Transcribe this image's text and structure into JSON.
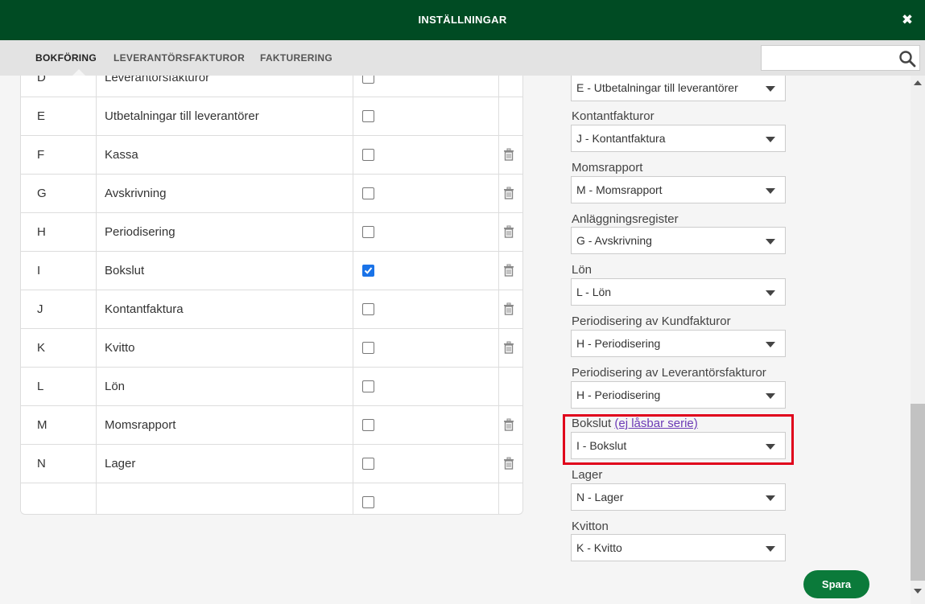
{
  "header": {
    "title": "INSTÄLLNINGAR",
    "close_glyph": "✖"
  },
  "tabs": [
    {
      "label": "BOKFÖRING",
      "active": true
    },
    {
      "label": "LEVERANTÖRSFAKTUROR",
      "active": false
    },
    {
      "label": "FAKTURERING",
      "active": false
    }
  ],
  "search": {
    "value": "",
    "placeholder": ""
  },
  "series_table": {
    "rows": [
      {
        "code": "D",
        "name": "Leverantörsfakturor",
        "checked": false,
        "deletable": false
      },
      {
        "code": "E",
        "name": "Utbetalningar till leverantörer",
        "checked": false,
        "deletable": false
      },
      {
        "code": "F",
        "name": "Kassa",
        "checked": false,
        "deletable": true
      },
      {
        "code": "G",
        "name": "Avskrivning",
        "checked": false,
        "deletable": true
      },
      {
        "code": "H",
        "name": "Periodisering",
        "checked": false,
        "deletable": true
      },
      {
        "code": "I",
        "name": "Bokslut",
        "checked": true,
        "deletable": true
      },
      {
        "code": "J",
        "name": "Kontantfaktura",
        "checked": false,
        "deletable": true
      },
      {
        "code": "K",
        "name": "Kvitto",
        "checked": false,
        "deletable": true
      },
      {
        "code": "L",
        "name": "Lön",
        "checked": false,
        "deletable": false
      },
      {
        "code": "M",
        "name": "Momsrapport",
        "checked": false,
        "deletable": true
      },
      {
        "code": "N",
        "name": "Lager",
        "checked": false,
        "deletable": true
      },
      {
        "code": "",
        "name": "",
        "checked": false,
        "deletable": false
      }
    ]
  },
  "settings": {
    "fields": [
      {
        "label": "",
        "link": "",
        "value": "E - Utbetalningar till leverantörer"
      },
      {
        "label": "Kontantfakturor",
        "link": "",
        "value": "J - Kontantfaktura"
      },
      {
        "label": "Momsrapport",
        "link": "",
        "value": "M - Momsrapport"
      },
      {
        "label": "Anläggningsregister",
        "link": "",
        "value": "G - Avskrivning"
      },
      {
        "label": "Lön",
        "link": "",
        "value": "L - Lön"
      },
      {
        "label": "Periodisering av Kundfakturor",
        "link": "",
        "value": "H - Periodisering"
      },
      {
        "label": "Periodisering av Leverantörsfakturor",
        "link": "",
        "value": "H - Periodisering"
      },
      {
        "label": "Bokslut",
        "link": "(ej låsbar serie)",
        "value": "I - Bokslut"
      },
      {
        "label": "Lager",
        "link": "",
        "value": "N - Lager"
      },
      {
        "label": "Kvitton",
        "link": "",
        "value": "K - Kvitto"
      }
    ]
  },
  "actions": {
    "save_label": "Spara"
  },
  "colors": {
    "header_bg": "#004b23",
    "save_bg": "#0b7a3a",
    "highlight": "#e0001b",
    "link": "#6c3bb6",
    "checkbox": "#1a73e8"
  }
}
